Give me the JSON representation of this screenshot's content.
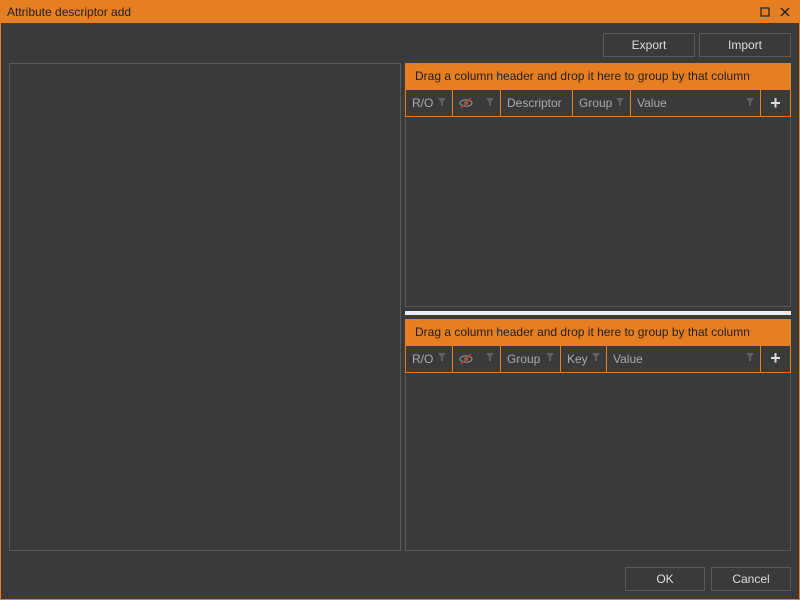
{
  "window": {
    "title": "Attribute descriptor add"
  },
  "toolbar": {
    "export_label": "Export",
    "import_label": "Import"
  },
  "grids": {
    "group_hint": "Drag a column header and drop it here to group by that column",
    "top": {
      "columns": {
        "ro": "R/O",
        "hidden": "",
        "descriptor": "Descriptor",
        "group": "Group",
        "value": "Value"
      }
    },
    "bottom": {
      "columns": {
        "ro": "R/O",
        "hidden": "",
        "group": "Group",
        "key": "Key",
        "value": "Value"
      }
    }
  },
  "footer": {
    "ok_label": "OK",
    "cancel_label": "Cancel"
  },
  "colors": {
    "accent": "#e67e22",
    "background": "#3a3a3a"
  }
}
